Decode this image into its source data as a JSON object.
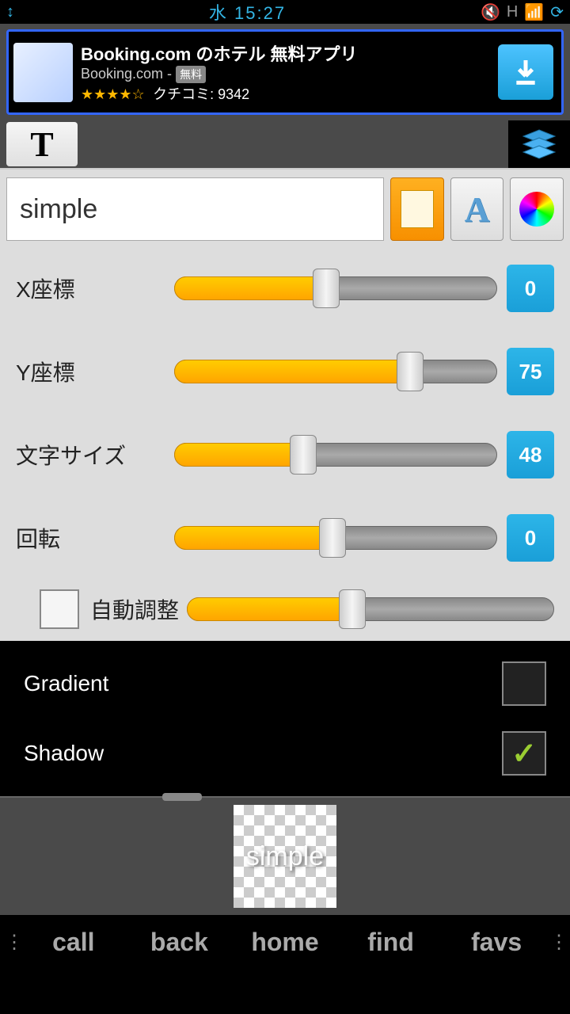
{
  "status": {
    "time_day": "水",
    "time": "15:27",
    "network": "H"
  },
  "ad": {
    "title": "Booking.com のホテル 無料アプリ",
    "subtitle": "Booking.com -",
    "free_tag": "無料",
    "stars": "★★★★☆",
    "reviews": "クチコミ: 9342"
  },
  "toolbar": {
    "text_icon": "T"
  },
  "input": {
    "value": "simple"
  },
  "sliders": {
    "x": {
      "label": "X座標",
      "value": "0",
      "fill": 47
    },
    "y": {
      "label": "Y座標",
      "value": "75",
      "fill": 73
    },
    "size": {
      "label": "文字サイズ",
      "value": "48",
      "fill": 40
    },
    "rotation": {
      "label": "回転",
      "value": "0",
      "fill": 49
    },
    "auto": {
      "label": "自動調整",
      "fill": 45
    }
  },
  "options": {
    "gradient": {
      "label": "Gradient",
      "checked": false
    },
    "shadow": {
      "label": "Shadow",
      "checked": true
    }
  },
  "preview": {
    "text": "simple"
  },
  "nav": {
    "call": "call",
    "back": "back",
    "home": "home",
    "find": "find",
    "favs": "favs"
  }
}
